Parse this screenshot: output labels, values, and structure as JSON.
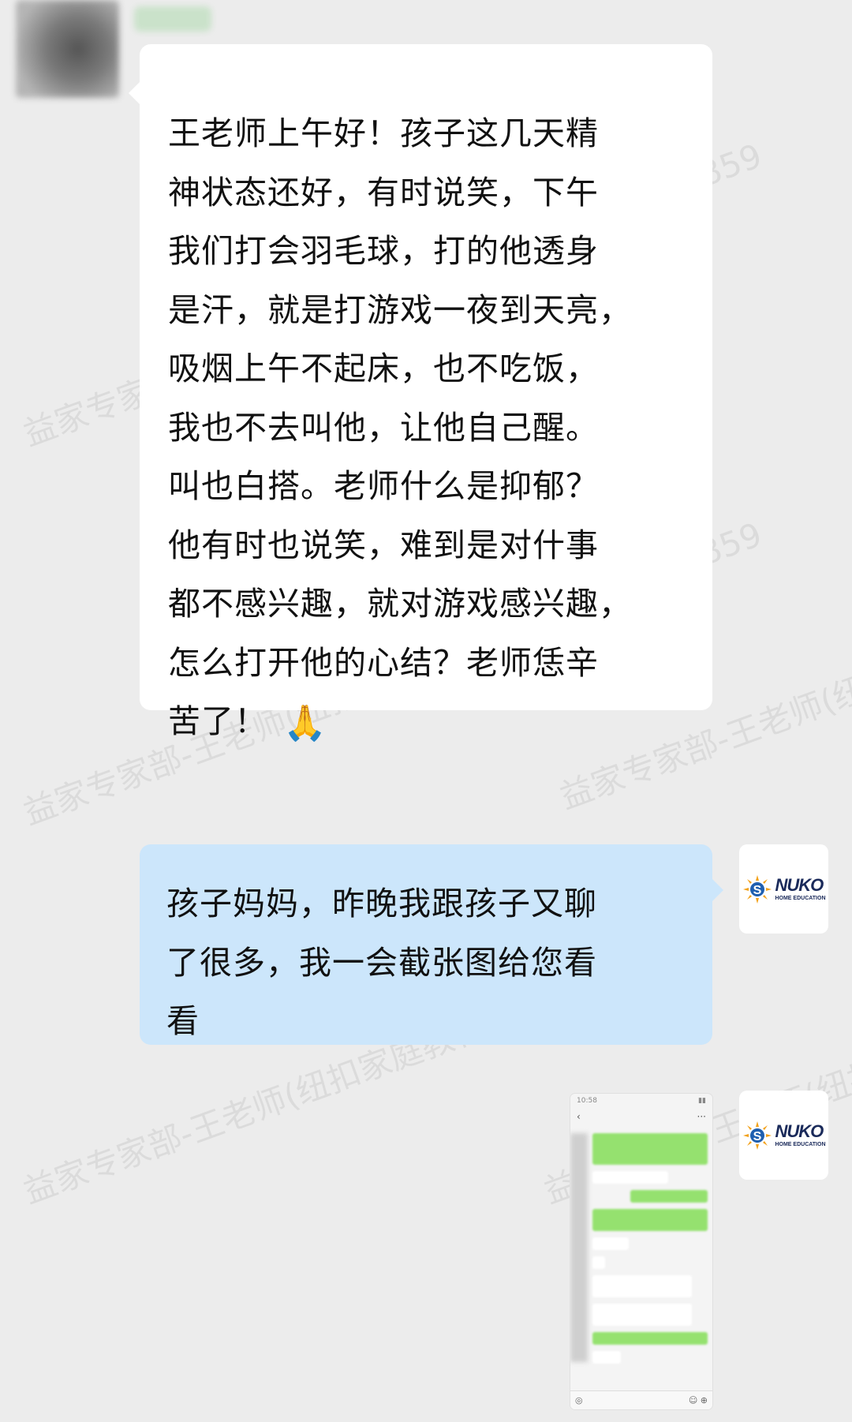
{
  "chat": {
    "incoming": {
      "lines": [
        "王老师上午好！孩子这几天精",
        "神状态还好，有时说笑，下午",
        "我们打会羽毛球，打的他透身",
        "是汗，就是打游戏一夜到天亮，",
        "吸烟上午不起床，也不吃饭，",
        "我也不去叫他，让他自己醒。",
        "叫也白搭。老师什么是抑郁？",
        "他有时也说笑，难到是对什事",
        "都不感兴趣，就对游戏感兴趣，",
        "怎么打开他的心结？老师恁辛",
        "苦了！"
      ],
      "emoji": "🙏"
    },
    "outgoing": {
      "lines": [
        "孩子妈妈，昨晚我跟孩子又聊",
        "了很多，我一会截张图给您看",
        "看"
      ]
    },
    "logo": {
      "brand": "NUKO",
      "sub": "HOME EDUCATION"
    },
    "screenshot": {
      "status_time": "10:58",
      "back": "‹",
      "more": "···"
    }
  },
  "watermark": {
    "a": "益家专家部-王老师(纽扣家庭教育",
    "b": "益家专家部-王老师(纽扣家庭教育-王老师)@纽扣家庭教育",
    "c": "859"
  },
  "colors": {
    "bg": "#ececec",
    "incoming": "#ffffff",
    "outgoing": "#cce6fb",
    "wechat_green": "#95e16f"
  }
}
